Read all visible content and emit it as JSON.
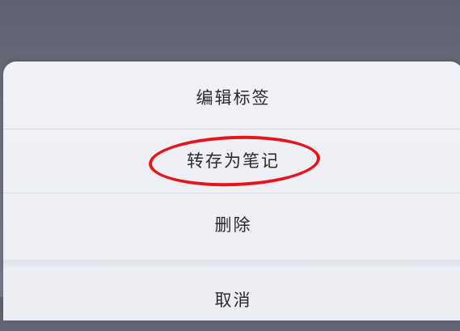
{
  "menu": {
    "items": [
      {
        "label": "编辑标签"
      },
      {
        "label": "转存为笔记"
      },
      {
        "label": "删除"
      },
      {
        "label": "取消"
      }
    ]
  },
  "annotation": {
    "color": "#e6141b"
  }
}
